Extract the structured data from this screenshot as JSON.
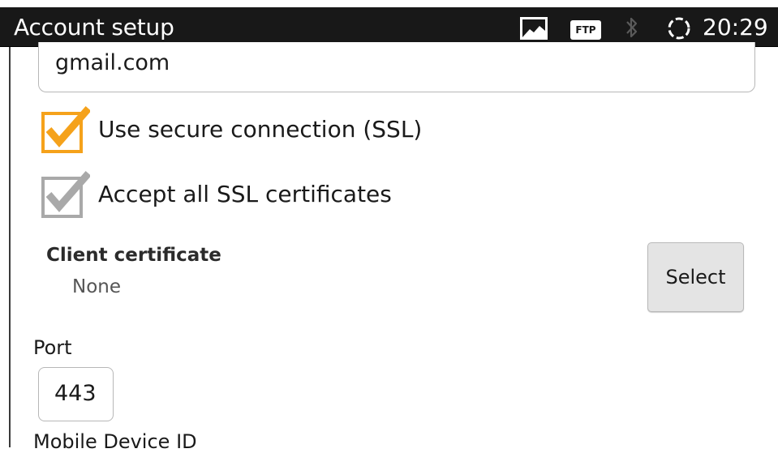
{
  "statusbar": {
    "title": "Account setup",
    "time": "20:29",
    "ftp_badge": "FTP",
    "icons": [
      "gallery-icon",
      "ftp-icon",
      "bluetooth-icon",
      "sync-icon"
    ]
  },
  "form": {
    "server_value": "gmail.com",
    "use_ssl": {
      "label": "Use secure connection (SSL)",
      "checked": true,
      "color": "#f5a21b"
    },
    "accept_certs": {
      "label": "Accept all SSL certificates",
      "checked": true,
      "color": "#a9a9a9"
    },
    "client_certificate": {
      "title": "Client certificate",
      "value": "None",
      "button_label": "Select"
    },
    "port": {
      "label": "Port",
      "value": "443"
    },
    "mobile_device_id": {
      "label": "Mobile Device ID"
    }
  }
}
